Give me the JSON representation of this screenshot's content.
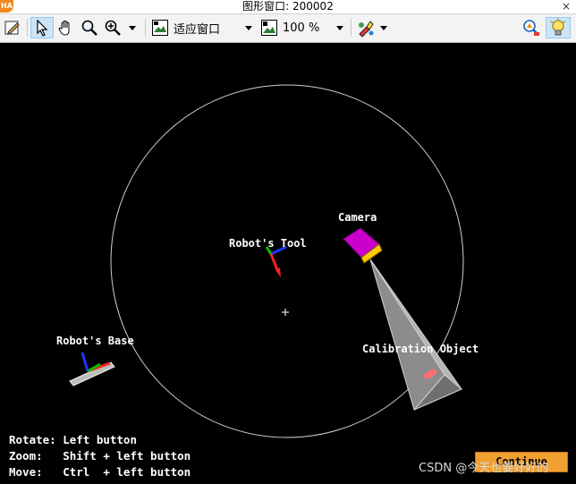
{
  "window": {
    "app_logo": "HA",
    "title": "图形窗口: 200002",
    "close_glyph": "×"
  },
  "toolbar": {
    "zoom_mode": "适应窗口",
    "zoom_percent": "100 %"
  },
  "scene": {
    "labels": {
      "robot_tool": "Robot's Tool",
      "camera": "Camera",
      "robot_base": "Robot's Base",
      "calibration_object": "Calibration Object"
    }
  },
  "hints": {
    "rotate": "Rotate: Left button",
    "zoom": "Zoom:   Shift + left button",
    "move": "Move:   Ctrl  + left button"
  },
  "continue_button": "Continue",
  "watermark": "CSDN @今天也要好好的",
  "colors": {
    "continue_button": "#f0a030",
    "camera_body": "#cc00cc",
    "selected_tool": "#cce4f7"
  }
}
